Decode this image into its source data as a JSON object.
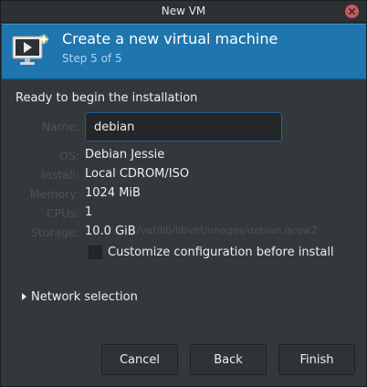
{
  "window": {
    "title": "New VM"
  },
  "banner": {
    "title": "Create a new virtual machine",
    "step": "Step 5 of 5",
    "icon": "monitor-play-icon"
  },
  "summary": {
    "heading": "Ready to begin the installation",
    "name_label": "Name:",
    "name_value": "debian",
    "os_label": "OS:",
    "os_value": "Debian Jessie",
    "install_label": "Install:",
    "install_value": "Local CDROM/ISO",
    "memory_label": "Memory:",
    "memory_value": "1024 MiB",
    "cpus_label": "CPUs:",
    "cpus_value": "1",
    "storage_label": "Storage:",
    "storage_value": "10.0 GiB",
    "storage_path": "/var/lib/libvirt/images/debian.qcow2",
    "customize_label": "Customize configuration before install",
    "customize_checked": false
  },
  "network": {
    "label": "Network selection",
    "expanded": false
  },
  "buttons": {
    "cancel": "Cancel",
    "back": "Back",
    "finish": "Finish"
  },
  "colors": {
    "banner": "#1f75ad",
    "window_bg": "#33393b",
    "close": "#cc575d",
    "input_focus": "#215d9c"
  }
}
